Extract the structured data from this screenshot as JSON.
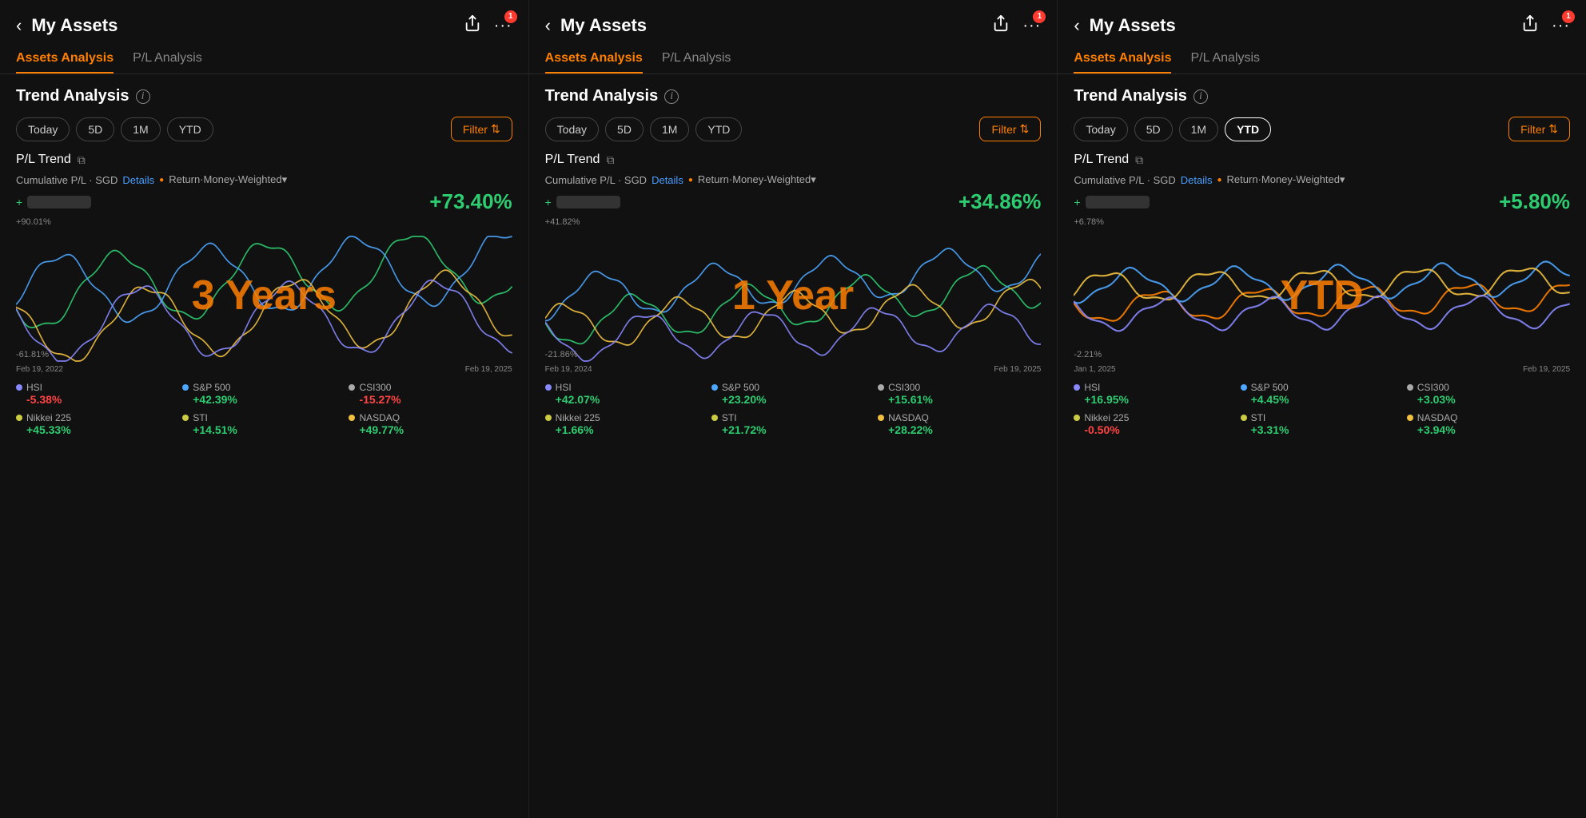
{
  "panels": [
    {
      "id": "panel-3y",
      "header": {
        "title": "My Assets",
        "badge": "1"
      },
      "tabs": [
        {
          "label": "Assets Analysis",
          "active": true
        },
        {
          "label": "P/L Analysis",
          "active": false
        }
      ],
      "sectionTitle": "Trend Analysis",
      "periods": [
        {
          "label": "Today",
          "active": false
        },
        {
          "label": "5D",
          "active": false
        },
        {
          "label": "1M",
          "active": false
        },
        {
          "label": "YTD",
          "active": false
        }
      ],
      "filter": "Filter",
      "plTrend": "P/L Trend",
      "metrics": {
        "cumulativeLabel": "Cumulative P/L · SGD",
        "detailsLabel": "Details",
        "returnLabel": "Return·Money-Weighted▾"
      },
      "returnValue": "+73.40%",
      "topPercent": "+90.01%",
      "bottomPercent": "-61.81%",
      "dateLeft": "Feb 19, 2022",
      "dateRight": "Feb 19, 2025",
      "overlayLabel": "3 Years",
      "legend": [
        {
          "name": "HSI",
          "color": "#8888ff",
          "value": "-5.38%",
          "green": false
        },
        {
          "name": "S&P 500",
          "color": "#4da6ff",
          "value": "+42.39%",
          "green": true
        },
        {
          "name": "CSI300",
          "color": "#aaaaaa",
          "value": "-15.27%",
          "green": false
        },
        {
          "name": "Nikkei 225",
          "color": "#cccc44",
          "value": "+45.33%",
          "green": true
        },
        {
          "name": "STI",
          "color": "#cccc44",
          "value": "+14.51%",
          "green": true
        },
        {
          "name": "NASDAQ",
          "color": "#f0c040",
          "value": "+49.77%",
          "green": true
        }
      ]
    },
    {
      "id": "panel-1y",
      "header": {
        "title": "My Assets",
        "badge": "1"
      },
      "tabs": [
        {
          "label": "Assets Analysis",
          "active": true
        },
        {
          "label": "P/L Analysis",
          "active": false
        }
      ],
      "sectionTitle": "Trend Analysis",
      "periods": [
        {
          "label": "Today",
          "active": false
        },
        {
          "label": "5D",
          "active": false
        },
        {
          "label": "1M",
          "active": false
        },
        {
          "label": "YTD",
          "active": false
        }
      ],
      "filter": "Filter",
      "plTrend": "P/L Trend",
      "metrics": {
        "cumulativeLabel": "Cumulative P/L · SGD",
        "detailsLabel": "Details",
        "returnLabel": "Return·Money-Weighted▾"
      },
      "returnValue": "+34.86%",
      "topPercent": "+41.82%",
      "bottomPercent": "-21.86%",
      "dateLeft": "Feb 19, 2024",
      "dateRight": "Feb 19, 2025",
      "overlayLabel": "1 Year",
      "legend": [
        {
          "name": "HSI",
          "color": "#8888ff",
          "value": "+42.07%",
          "green": true
        },
        {
          "name": "S&P 500",
          "color": "#4da6ff",
          "value": "+23.20%",
          "green": true
        },
        {
          "name": "CSI300",
          "color": "#aaaaaa",
          "value": "+15.61%",
          "green": true
        },
        {
          "name": "Nikkei 225",
          "color": "#cccc44",
          "value": "+1.66%",
          "green": true
        },
        {
          "name": "STI",
          "color": "#cccc44",
          "value": "+21.72%",
          "green": true
        },
        {
          "name": "NASDAQ",
          "color": "#f0c040",
          "value": "+28.22%",
          "green": true
        }
      ]
    },
    {
      "id": "panel-ytd",
      "header": {
        "title": "My Assets",
        "badge": "1"
      },
      "tabs": [
        {
          "label": "Assets Analysis",
          "active": true
        },
        {
          "label": "P/L Analysis",
          "active": false
        }
      ],
      "sectionTitle": "Trend Analysis",
      "periods": [
        {
          "label": "Today",
          "active": false
        },
        {
          "label": "5D",
          "active": false
        },
        {
          "label": "1M",
          "active": false
        },
        {
          "label": "YTD",
          "active": true
        }
      ],
      "filter": "Filter",
      "plTrend": "P/L Trend",
      "metrics": {
        "cumulativeLabel": "Cumulative P/L · SGD",
        "detailsLabel": "Details",
        "returnLabel": "Return·Money-Weighted▾"
      },
      "returnValue": "+5.80%",
      "topPercent": "+6.78%",
      "bottomPercent": "-2.21%",
      "dateLeft": "Jan 1, 2025",
      "dateRight": "Feb 19, 2025",
      "overlayLabel": "YTD",
      "legend": [
        {
          "name": "HSI",
          "color": "#8888ff",
          "value": "+16.95%",
          "green": true
        },
        {
          "name": "S&P 500",
          "color": "#4da6ff",
          "value": "+4.45%",
          "green": true
        },
        {
          "name": "CSI300",
          "color": "#aaaaaa",
          "value": "+3.03%",
          "green": true
        },
        {
          "name": "Nikkei 225",
          "color": "#cccc44",
          "value": "-0.50%",
          "green": false
        },
        {
          "name": "STI",
          "color": "#cccc44",
          "value": "+3.31%",
          "green": true
        },
        {
          "name": "NASDAQ",
          "color": "#f0c040",
          "value": "+3.94%",
          "green": true
        }
      ]
    }
  ],
  "icons": {
    "back": "‹",
    "share": "⬆",
    "more": "···",
    "copy": "⧉",
    "info": "i",
    "filter_symbol": "⇅"
  }
}
